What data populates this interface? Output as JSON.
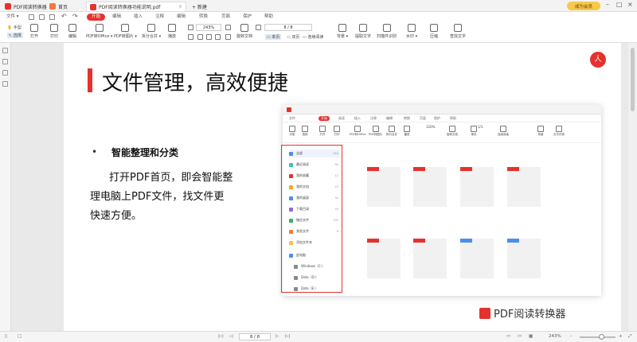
{
  "titlebar": {
    "app_tab": "PDF阅读转换器",
    "tabs": [
      {
        "label": "首页"
      },
      {
        "label": "PDF阅读转换器功能说明.pdf"
      }
    ],
    "new_tab": "+ 新建",
    "vip": "成为会员"
  },
  "menubar": {
    "file": "文件 ▾",
    "items": [
      "开始",
      "编辑",
      "插入",
      "注释",
      "编辑",
      "转换",
      "页面",
      "保护",
      "帮助"
    ],
    "active": "开始"
  },
  "toolbar": {
    "hand": "手型",
    "select": "选择",
    "open": "打开",
    "print": "打印",
    "edit": "编辑",
    "pdf_office": "PDF转Office ▾",
    "pdf_image": "PDF转图片 ▾",
    "split_merge": "拆分合并 ▾",
    "play": "播放",
    "zoom": "243%",
    "page": "8 / 8",
    "rotate": "旋转文档",
    "single": "单页",
    "double": "双页",
    "continuous": "连续阅读",
    "background": "背景 ▾",
    "extract_text": "提取文字",
    "scan_ocr": "扫描件识别",
    "watermark": "水印 ▾",
    "compress": "压缩",
    "find": "查找文字"
  },
  "slide": {
    "title": "文件管理，高效便捷",
    "bullet": "•",
    "bullet_title": "智能整理和分类",
    "para": [
      "打开PDF首页，即会智能整",
      "理电脑上PDF文件，找文件更",
      "快速方便。"
    ],
    "logo_text": "人",
    "brand": "PDF阅读转换器"
  },
  "mini": {
    "menu": [
      "文件",
      "开始",
      "阅读",
      "插入",
      "注释",
      "编辑",
      "转换",
      "页面",
      "保护",
      "帮助"
    ],
    "tools": [
      "手型",
      "选择",
      "打开",
      "打印",
      "PDF转Office",
      "PDF转图片",
      "拆分合并",
      "播放",
      "旋转文档",
      "单页",
      "连续阅读",
      "背景",
      "文字识别"
    ],
    "zoom": "120%",
    "page": "1/1",
    "sidebar": [
      {
        "label": "全部",
        "count": "264",
        "color": "#4a8ef0"
      },
      {
        "label": "最近阅读",
        "count": "95",
        "color": "#3cc3b5"
      },
      {
        "label": "我的收藏",
        "count": "12",
        "color": "#e5322d"
      },
      {
        "label": "我的文档",
        "count": "20",
        "color": "#f5a623"
      },
      {
        "label": "我的桌面",
        "count": "30",
        "color": "#4a8ef0"
      },
      {
        "label": "下载目录",
        "count": "30",
        "color": "#8e6bd8"
      },
      {
        "label": "微信文件",
        "count": "100",
        "color": "#2fb36b"
      },
      {
        "label": "其他文件",
        "count": "8",
        "color": "#f07b3f"
      },
      {
        "label": "添加文件夹",
        "count": "",
        "color": "#f5c242"
      },
      {
        "label": "此电脑",
        "count": "",
        "color": "#4a8ef0"
      },
      {
        "label": "Windows（C:）",
        "count": "",
        "color": "#888888"
      },
      {
        "label": "Data（D:）",
        "count": "",
        "color": "#888888"
      },
      {
        "label": "Data（E:）",
        "count": "",
        "color": "#888888"
      }
    ]
  },
  "status": {
    "page": "8 / 8",
    "zoom": "243%"
  }
}
